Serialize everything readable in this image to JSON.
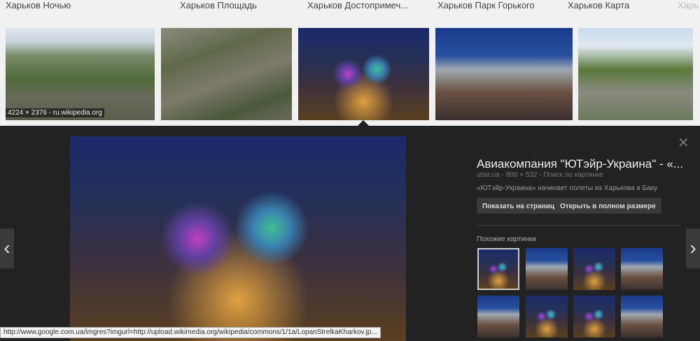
{
  "related_searches": [
    "Харьков Ночью",
    "Харьков Площадь",
    "Харьков Достопримеч...",
    "Харьков Парк Горького",
    "Харьков Карта",
    "Харь"
  ],
  "thumbnails": [
    {
      "caption": "4224 × 2376 - ru.wikipedia.org"
    },
    {},
    {
      "selected": true
    },
    {},
    {}
  ],
  "preview": {
    "title": "Авиакомпания \"ЮТэйр-Украина\" - «...",
    "meta": "utair.ua - 800 × 532 - Поиск по картинке",
    "description": "«ЮТэйр-Украина» начинает полеты из Харькова в Баку",
    "show_on_page": "Показать на странице",
    "open_full": "Открыть в полном размере",
    "similar_label": "Похожие картинки",
    "close": "✕",
    "prev": "‹",
    "next": "›"
  },
  "status_url": "http://www.google.com.ua/imgres?imgurl=http://upload.wikimedia.org/wikipedia/commons/1/1a/LopanStrelkaKharkov.jp..."
}
